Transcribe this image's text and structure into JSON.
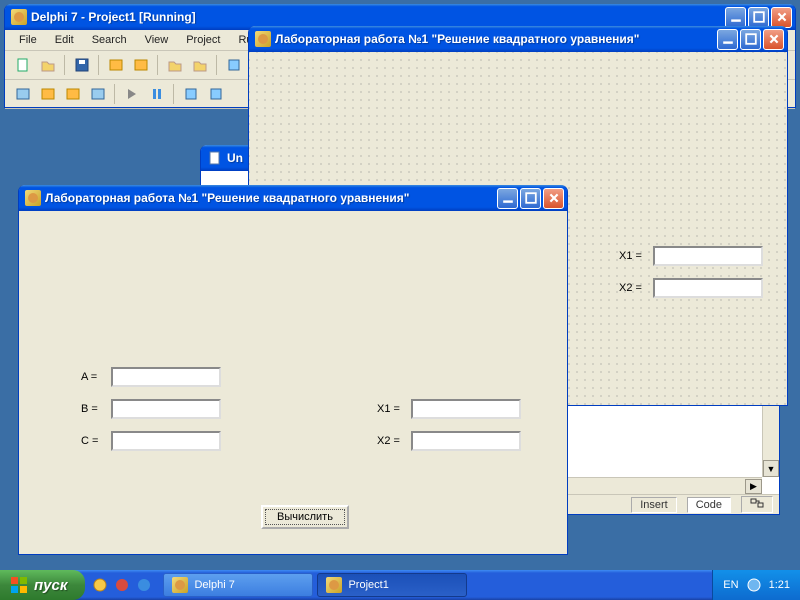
{
  "ide": {
    "title": "Delphi 7 - Project1 [Running]",
    "menu": [
      "File",
      "Edit",
      "Search",
      "View",
      "Project",
      "Run"
    ]
  },
  "unit_window": {
    "title": "Un",
    "status": {
      "mode": "Insert",
      "tab": "Code"
    }
  },
  "design_form": {
    "title": "Лабораторная работа №1 \"Решение квадратного уравнения\"",
    "x1_label": "X1 =",
    "x2_label": "X2 ="
  },
  "app": {
    "title": "Лабораторная работа №1 \"Решение квадратного уравнения\"",
    "a_label": "A =",
    "b_label": "B =",
    "c_label": "C =",
    "x1_label": "X1 =",
    "x2_label": "X2 =",
    "button": "Вычислить"
  },
  "taskbar": {
    "start": "пуск",
    "tasks": [
      "Delphi 7",
      "Project1"
    ],
    "lang": "EN",
    "clock": "1:21"
  }
}
